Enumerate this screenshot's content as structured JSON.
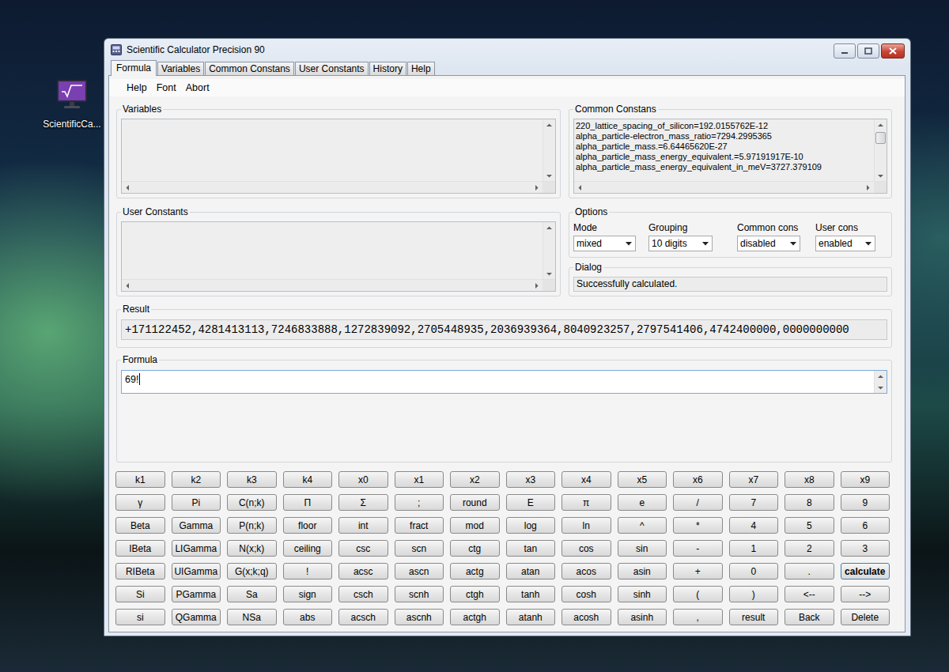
{
  "desktop": {
    "icons": [
      {
        "label": "ScientificCa..."
      }
    ]
  },
  "window": {
    "title": "Scientific Calculator Precision 90"
  },
  "tabs": [
    {
      "label": "Formula",
      "selected": true
    },
    {
      "label": "Variables",
      "selected": false
    },
    {
      "label": "Common Constans",
      "selected": false
    },
    {
      "label": "User Constants",
      "selected": false
    },
    {
      "label": "History",
      "selected": false
    },
    {
      "label": "Help",
      "selected": false
    }
  ],
  "menu": [
    "Help",
    "Font",
    "Abort"
  ],
  "variables": {
    "title": "Variables",
    "items": []
  },
  "common_constants": {
    "title": "Common Constans",
    "items": [
      "220_lattice_spacing_of_silicon=192.0155762E-12",
      "alpha_particle-electron_mass_ratio=7294.2995365",
      "alpha_particle_mass.=6.64465620E-27",
      "alpha_particle_mass_energy_equivalent.=5.97191917E-10",
      "alpha_particle_mass_energy_equivalent_in_meV=3727.379109"
    ]
  },
  "user_constants": {
    "title": "User Constants",
    "items": []
  },
  "options": {
    "title": "Options",
    "fields": [
      {
        "label": "Mode",
        "value": "mixed"
      },
      {
        "label": "Grouping",
        "value": "10 digits"
      },
      {
        "label": "Common cons",
        "value": "disabled"
      },
      {
        "label": "User cons",
        "value": "enabled"
      }
    ]
  },
  "dialog": {
    "title": "Dialog",
    "message": "Successfully calculated."
  },
  "result": {
    "title": "Result",
    "value": "+171122452,4281413113,7246833888,1272839092,2705448935,2036939364,8040923257,2797541406,4742400000,0000000000"
  },
  "formula": {
    "title": "Formula",
    "value": "69!"
  },
  "keypad": {
    "rows": [
      [
        {
          "label": "k1",
          "default": false
        },
        {
          "label": "k2",
          "default": false
        },
        {
          "label": "k3",
          "default": false
        },
        {
          "label": "k4",
          "default": false
        },
        {
          "label": "x0",
          "default": false
        },
        {
          "label": "x1",
          "default": false
        },
        {
          "label": "x2",
          "default": false
        },
        {
          "label": "x3",
          "default": false
        },
        {
          "label": "x4",
          "default": false
        },
        {
          "label": "x5",
          "default": false
        },
        {
          "label": "x6",
          "default": false
        },
        {
          "label": "x7",
          "default": false
        },
        {
          "label": "x8",
          "default": false
        },
        {
          "label": "x9",
          "default": false
        }
      ],
      [
        {
          "label": "γ",
          "default": false
        },
        {
          "label": "Pi",
          "default": false
        },
        {
          "label": "C(n;k)",
          "default": false
        },
        {
          "label": "Π",
          "default": false
        },
        {
          "label": "Σ",
          "default": false
        },
        {
          "label": ";",
          "default": false
        },
        {
          "label": "round",
          "default": false
        },
        {
          "label": "E",
          "default": false
        },
        {
          "label": "π",
          "default": false
        },
        {
          "label": "e",
          "default": false
        },
        {
          "label": "/",
          "default": false
        },
        {
          "label": "7",
          "default": false
        },
        {
          "label": "8",
          "default": false
        },
        {
          "label": "9",
          "default": false
        }
      ],
      [
        {
          "label": "Beta",
          "default": false
        },
        {
          "label": "Gamma",
          "default": false
        },
        {
          "label": "P(n;k)",
          "default": false
        },
        {
          "label": "floor",
          "default": false
        },
        {
          "label": "int",
          "default": false
        },
        {
          "label": "fract",
          "default": false
        },
        {
          "label": "mod",
          "default": false
        },
        {
          "label": "log",
          "default": false
        },
        {
          "label": "ln",
          "default": false
        },
        {
          "label": "^",
          "default": false
        },
        {
          "label": "*",
          "default": false
        },
        {
          "label": "4",
          "default": false
        },
        {
          "label": "5",
          "default": false
        },
        {
          "label": "6",
          "default": false
        }
      ],
      [
        {
          "label": "IBeta",
          "default": false
        },
        {
          "label": "LIGamma",
          "default": false
        },
        {
          "label": "N(x;k)",
          "default": false
        },
        {
          "label": "ceiling",
          "default": false
        },
        {
          "label": "csc",
          "default": false
        },
        {
          "label": "scn",
          "default": false
        },
        {
          "label": "ctg",
          "default": false
        },
        {
          "label": "tan",
          "default": false
        },
        {
          "label": "cos",
          "default": false
        },
        {
          "label": "sin",
          "default": false
        },
        {
          "label": "-",
          "default": false
        },
        {
          "label": "1",
          "default": false
        },
        {
          "label": "2",
          "default": false
        },
        {
          "label": "3",
          "default": false
        }
      ],
      [
        {
          "label": "RIBeta",
          "default": false
        },
        {
          "label": "UIGamma",
          "default": false
        },
        {
          "label": "G(x;k;q)",
          "default": false
        },
        {
          "label": "!",
          "default": false
        },
        {
          "label": "acsc",
          "default": false
        },
        {
          "label": "ascn",
          "default": false
        },
        {
          "label": "actg",
          "default": false
        },
        {
          "label": "atan",
          "default": false
        },
        {
          "label": "acos",
          "default": false
        },
        {
          "label": "asin",
          "default": false
        },
        {
          "label": "+",
          "default": false
        },
        {
          "label": "0",
          "default": false
        },
        {
          "label": ".",
          "default": false
        },
        {
          "label": "calculate",
          "default": true
        }
      ],
      [
        {
          "label": "Si",
          "default": false
        },
        {
          "label": "PGamma",
          "default": false
        },
        {
          "label": "Sa",
          "default": false
        },
        {
          "label": "sign",
          "default": false
        },
        {
          "label": "csch",
          "default": false
        },
        {
          "label": "scnh",
          "default": false
        },
        {
          "label": "ctgh",
          "default": false
        },
        {
          "label": "tanh",
          "default": false
        },
        {
          "label": "cosh",
          "default": false
        },
        {
          "label": "sinh",
          "default": false
        },
        {
          "label": "(",
          "default": false
        },
        {
          "label": ")",
          "default": false
        },
        {
          "label": "<--",
          "default": false
        },
        {
          "label": "-->",
          "default": false
        }
      ],
      [
        {
          "label": "si",
          "default": false
        },
        {
          "label": "QGamma",
          "default": false
        },
        {
          "label": "NSa",
          "default": false
        },
        {
          "label": "abs",
          "default": false
        },
        {
          "label": "acsch",
          "default": false
        },
        {
          "label": "ascnh",
          "default": false
        },
        {
          "label": "actgh",
          "default": false
        },
        {
          "label": "atanh",
          "default": false
        },
        {
          "label": "acosh",
          "default": false
        },
        {
          "label": "asinh",
          "default": false
        },
        {
          "label": ",",
          "default": false
        },
        {
          "label": "result",
          "default": false
        },
        {
          "label": "Back",
          "default": false
        },
        {
          "label": "Delete",
          "default": false
        }
      ]
    ]
  }
}
